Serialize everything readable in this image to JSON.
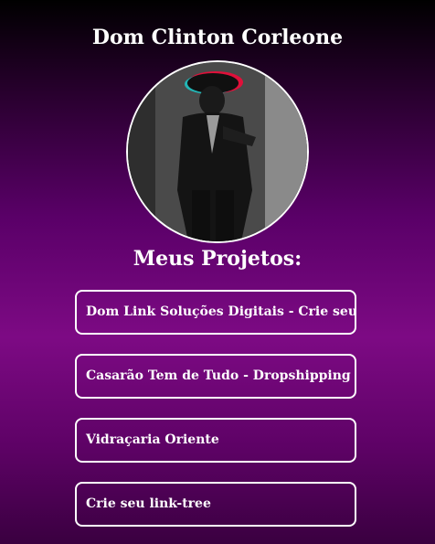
{
  "profile": {
    "name": "Dom Clinton Corleone",
    "avatar_icon": "person-in-suit-photo"
  },
  "projects": {
    "title": "Meus Projetos:",
    "items": [
      {
        "label": "Dom Link Soluções Digitais - Crie seu site"
      },
      {
        "label": "Casarão Tem de Tudo - Dropshipping"
      },
      {
        "label": "Vidraçaria Oriente"
      },
      {
        "label": "Crie seu link-tree"
      }
    ]
  },
  "colors": {
    "background_top": "#000000",
    "background_mid": "#7d0a84",
    "text": "#ffffff",
    "border": "#ffffff"
  }
}
